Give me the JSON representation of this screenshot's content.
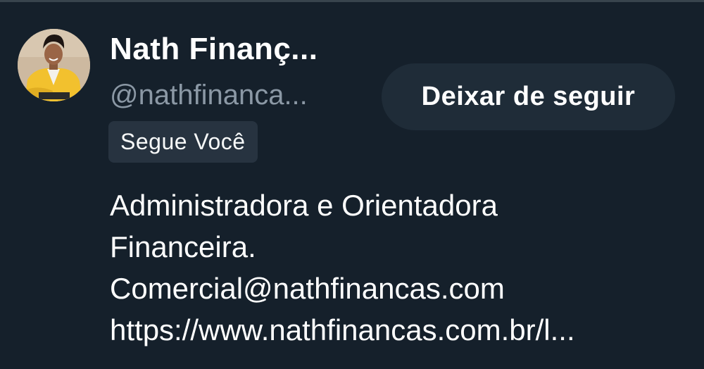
{
  "profile": {
    "name": "Nath Finanç...",
    "handle": "@nathfinanca...",
    "follows_you_label": "Segue Você",
    "unfollow_label": "Deixar de seguir",
    "bio_lines": [
      "Administradora e Orientadora",
      "Financeira.",
      "Comercial@nathfinancas.com",
      "https://www.nathfinancas.com.br/l..."
    ]
  },
  "colors": {
    "background": "#15202b",
    "secondary_text": "#8b98a5",
    "badge_bg": "#273340",
    "button_bg": "#1f2c38"
  },
  "icons": {
    "avatar": "profile-photo"
  }
}
